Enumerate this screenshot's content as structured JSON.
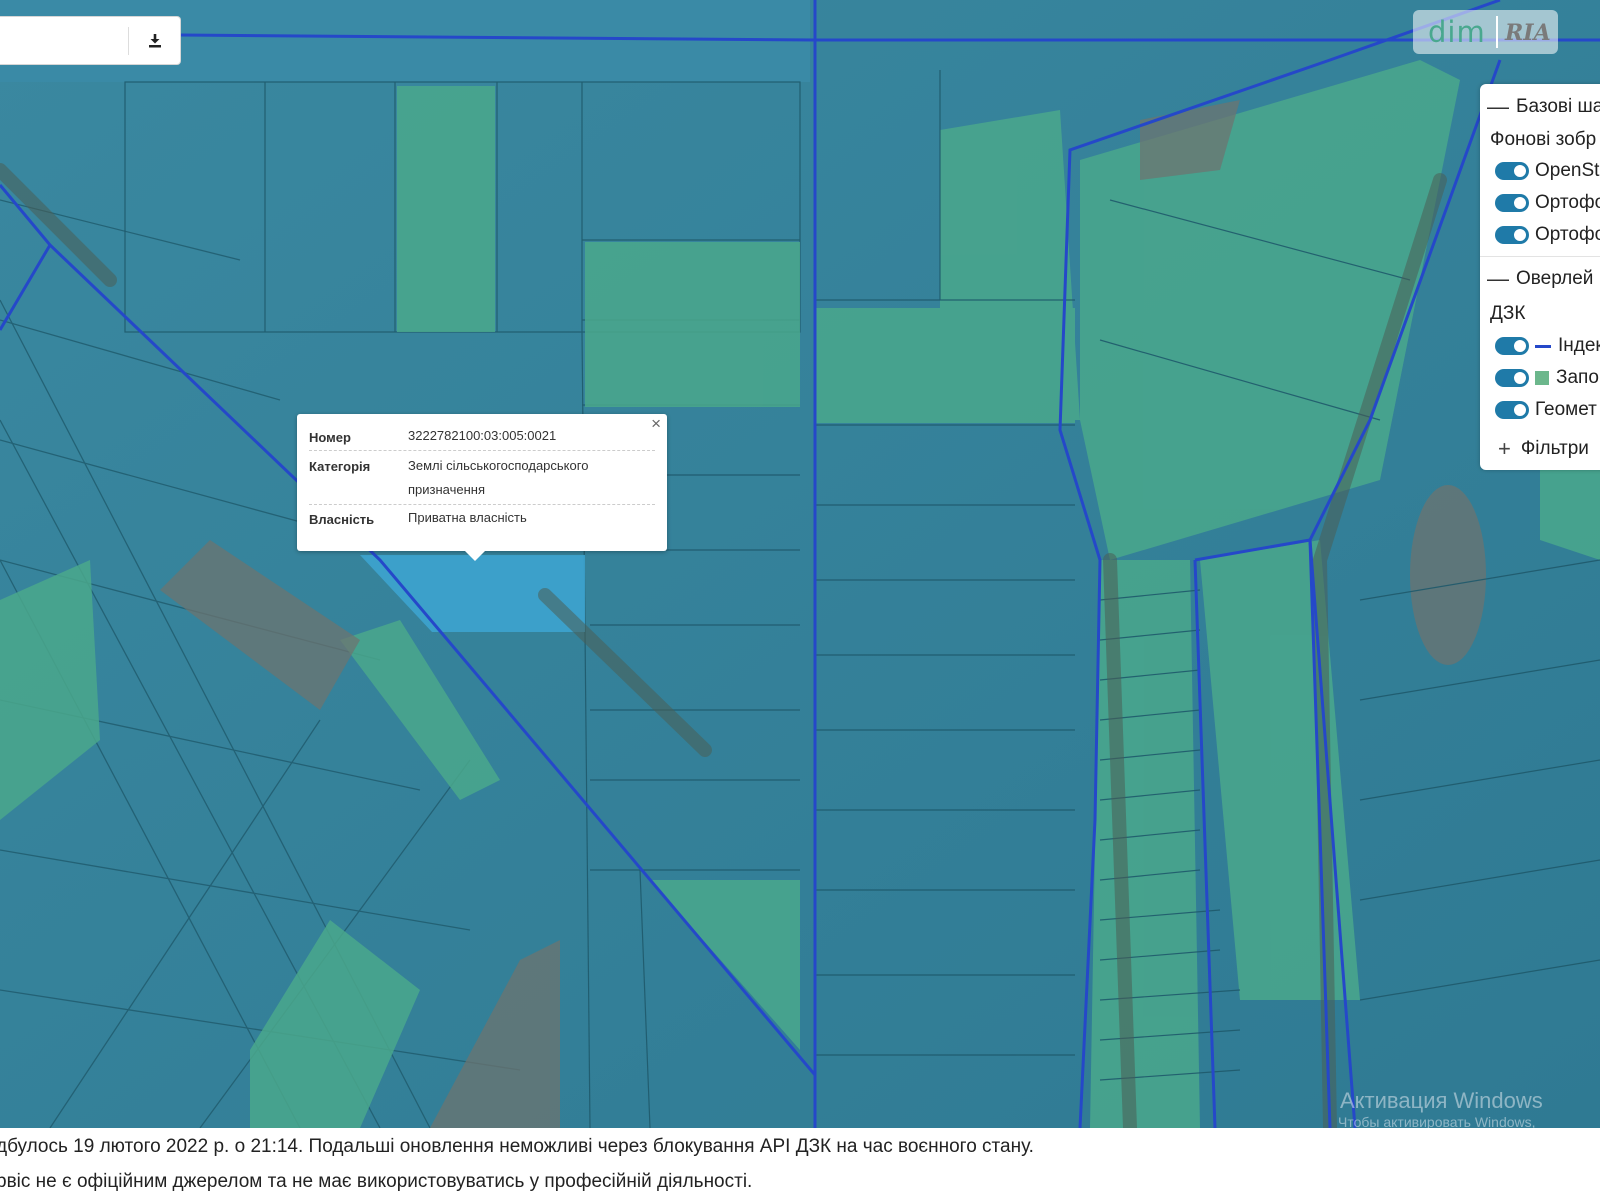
{
  "search": {
    "value": "",
    "download_icon": "download-icon"
  },
  "logo": {
    "text1": "dim",
    "text2": "RIA"
  },
  "layers_panel": {
    "base_header": "Базові ша",
    "base_group": "Фонові зобр",
    "base_items": [
      "OpenSt",
      "Ортофо",
      "Ортофо"
    ],
    "overlay_header": "Оверлей",
    "overlay_group": "ДЗК",
    "overlay_items": [
      "Індек",
      "Запо",
      "Геомет"
    ],
    "filters": "Фільтри",
    "colors": {
      "toggle": "#1f7aa8",
      "cadastral_line": "#2548c9",
      "parcel_fill": "#6cb78c"
    }
  },
  "popup": {
    "close": "×",
    "rows": [
      {
        "label": "Номер",
        "value": "3222782100:03:005:0021"
      },
      {
        "label": "Категорія",
        "value": "Землі сільськогосподарського призначення"
      },
      {
        "label": "Власність",
        "value": "Приватна власність"
      }
    ]
  },
  "watermark": {
    "line1": "Активация Windows",
    "line2": "Чтобы активировать Windows,"
  },
  "footer": {
    "line1_pre": "дбулось 19 лютого 2022 р. о 21:14. Подальші оновлення неможливі через блокування ",
    "line1_bold": "API ДЗК",
    "line1_post": " на час воєнного стану.",
    "line2": "рвіс не є офіційним джерелом та не має використовуватись у професійній діяльності."
  }
}
